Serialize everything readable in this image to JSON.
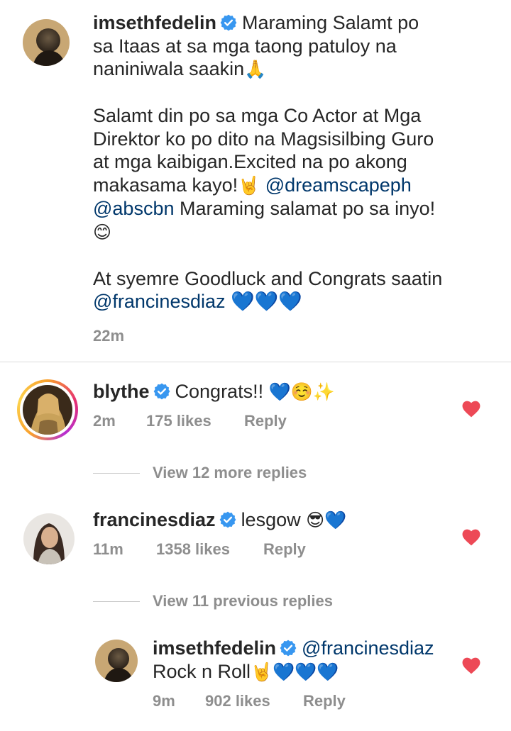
{
  "main_comment": {
    "username": "imsethfedelin",
    "text_line1": "Maraming Salamt po",
    "text_line2": "sa Itaas at sa mga taong patuloy na",
    "text_line3": "naniniwala saakin",
    "emoji_pray": "🙏",
    "para2_line1": "Salamt din po sa mga Co Actor at Mga",
    "para2_line2": "Direktor ko po dito na Magsisilbing Guro",
    "para2_line3": "at mga kaibigan.Excited na po akong",
    "para2_line4": "makasama kayo!",
    "emoji_rock": "🤘",
    "mention1": "@dreamscapeph",
    "mention2": "@abscbn",
    "para2_line5_rest": " Maraming salamat po sa inyo!",
    "emoji_smile": "😊",
    "para3_line1": "At syemre Goodluck and Congrats saatin",
    "mention3": "@francinesdiaz",
    "hearts": "💙💙💙",
    "time": "22m"
  },
  "comments": [
    {
      "username": "blythe",
      "text": "Congrats!!",
      "emojis": "💙☺️✨",
      "time": "2m",
      "likes": "175 likes",
      "reply": "Reply"
    },
    {
      "username": "francinesdiaz",
      "text": "lesgow",
      "emojis": "😎💙",
      "time": "11m",
      "likes": "1358 likes",
      "reply": "Reply"
    }
  ],
  "view_more_replies": "View 12 more replies",
  "view_previous_replies": "View 11 previous replies",
  "reply": {
    "username": "imsethfedelin",
    "mention": "@francinesdiaz",
    "text": "Rock n Roll",
    "emojis": "🤘💙💙💙",
    "time": "9m",
    "likes": "902 likes",
    "reply": "Reply"
  },
  "colors": {
    "like_heart": "#ed4956",
    "verified_badge": "#3897f0",
    "mention": "#00376b",
    "meta_text": "#8e8e8e"
  },
  "icons": {
    "verified": "verified-badge-icon",
    "like": "heart-filled-icon"
  }
}
